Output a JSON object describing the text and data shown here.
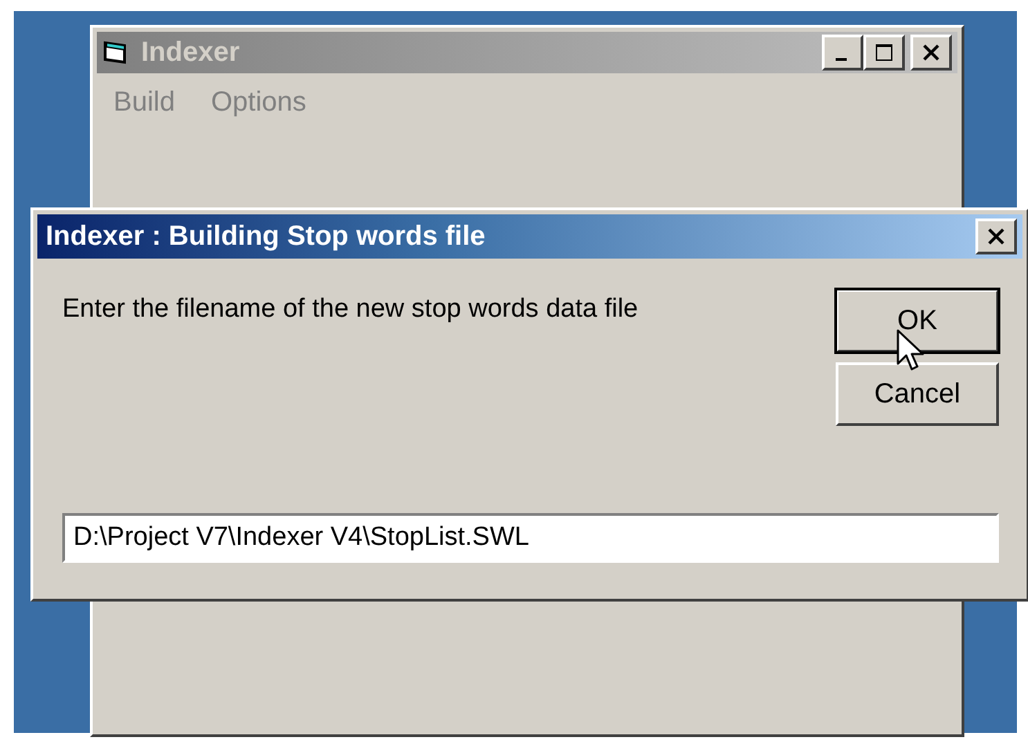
{
  "main_window": {
    "title": "Indexer",
    "active": false,
    "menu": [
      {
        "label": "Build",
        "disabled": true
      },
      {
        "label": "Options",
        "disabled": true
      }
    ]
  },
  "dialog": {
    "title": "Indexer : Building Stop words file",
    "active": true,
    "message": "Enter the filename of the new stop words data file",
    "buttons": [
      {
        "label": "OK",
        "default": true
      },
      {
        "label": "Cancel",
        "default": false
      }
    ],
    "filename": {
      "value": "D:\\Project V7\\Indexer V4\\StopList.SWL"
    }
  }
}
